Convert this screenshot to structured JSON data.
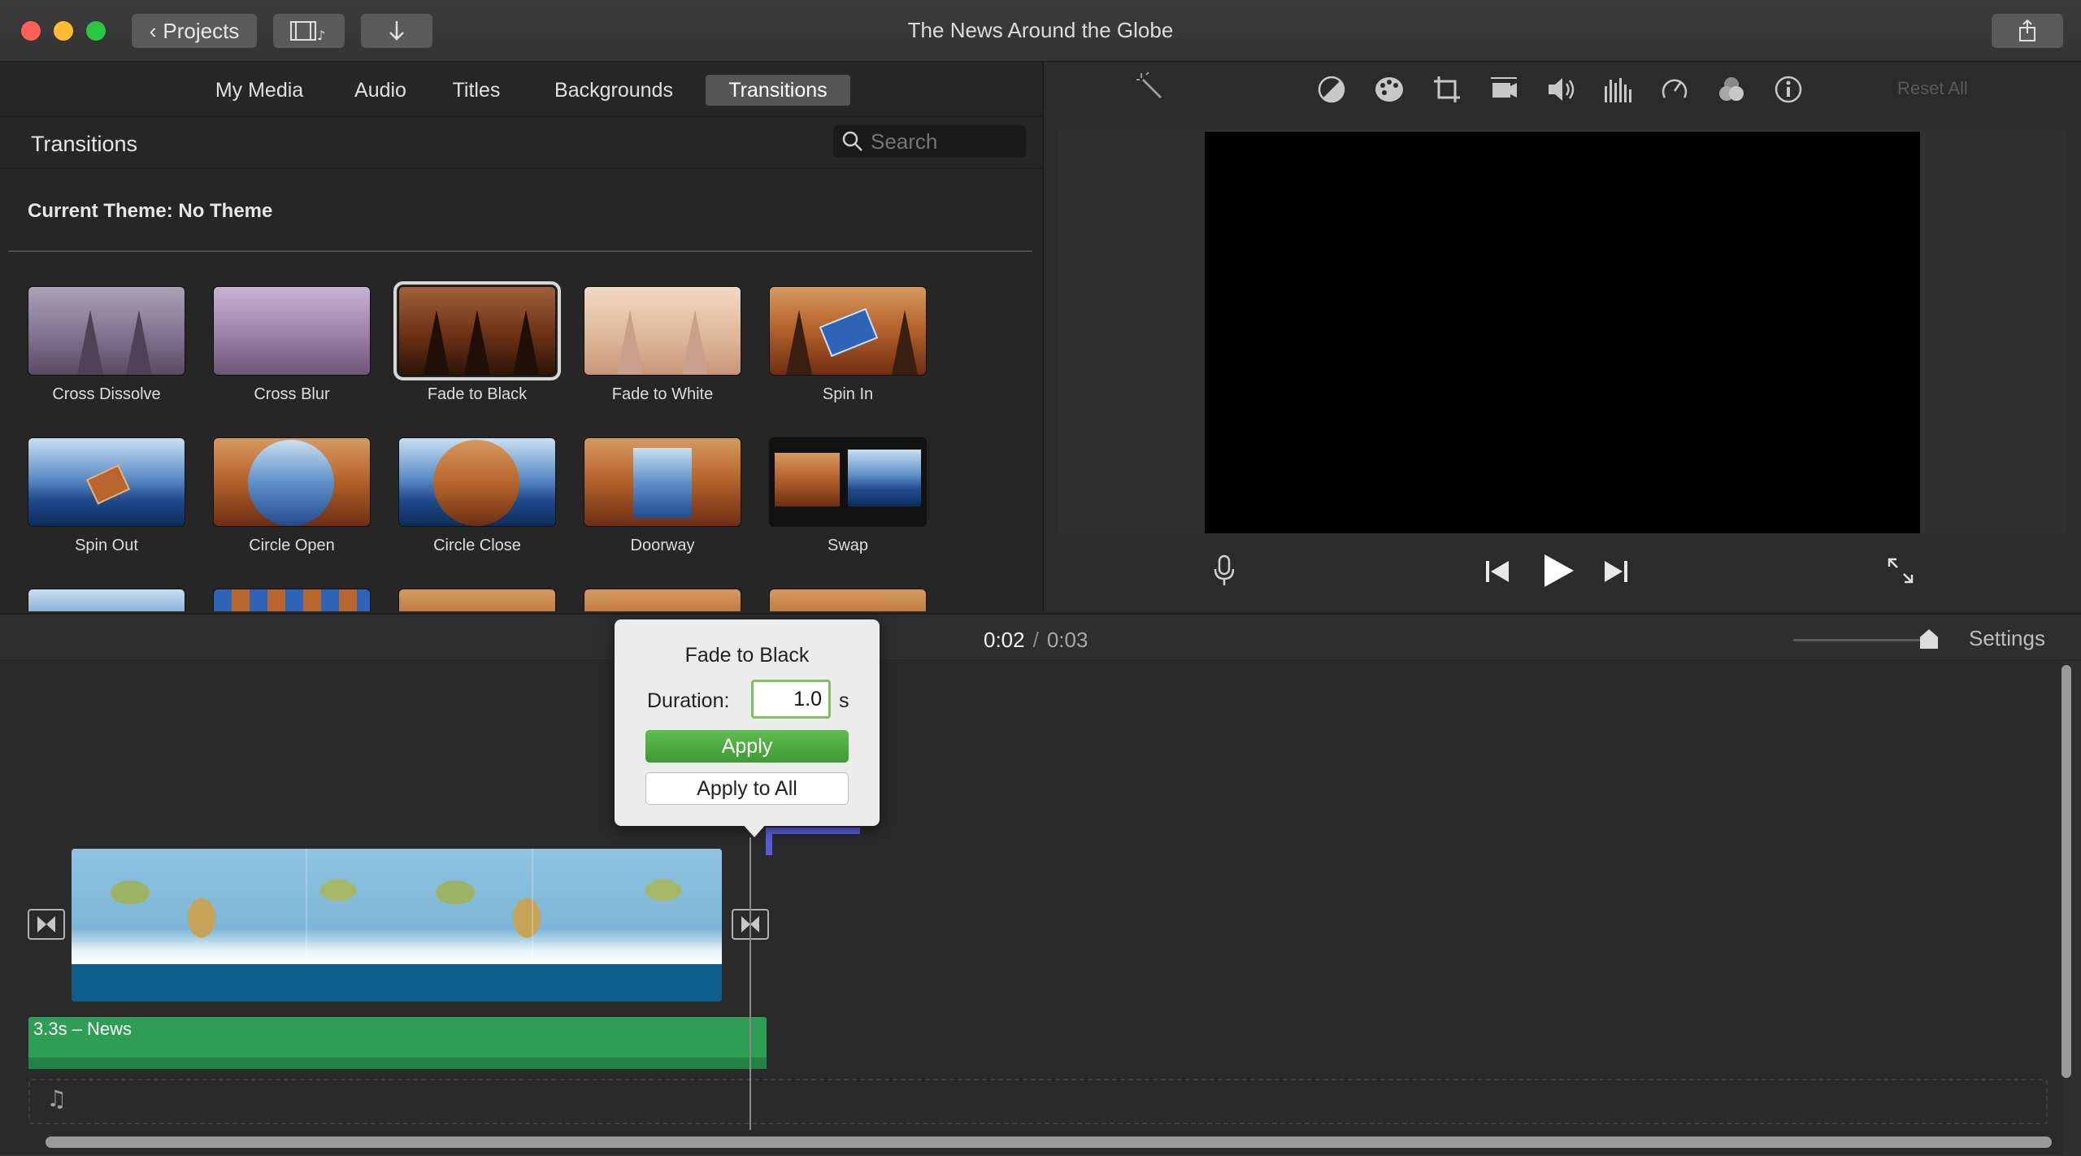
{
  "window": {
    "title": "The News Around the Globe"
  },
  "toolbar": {
    "projects_label": "Projects"
  },
  "browser": {
    "tabs": [
      {
        "label": "My Media",
        "active": false
      },
      {
        "label": "Audio",
        "active": false
      },
      {
        "label": "Titles",
        "active": false
      },
      {
        "label": "Backgrounds",
        "active": false
      },
      {
        "label": "Transitions",
        "active": true
      }
    ],
    "section_title": "Transitions",
    "search_placeholder": "Search",
    "theme_label": "Current Theme: No Theme",
    "transitions": [
      {
        "label": "Cross Dissolve"
      },
      {
        "label": "Cross Blur"
      },
      {
        "label": "Fade to Black",
        "selected": true
      },
      {
        "label": "Fade to White"
      },
      {
        "label": "Spin In"
      },
      {
        "label": "Spin Out"
      },
      {
        "label": "Circle Open"
      },
      {
        "label": "Circle Close"
      },
      {
        "label": "Doorway"
      },
      {
        "label": "Swap"
      }
    ]
  },
  "viewer": {
    "reset_label": "Reset All"
  },
  "timeline": {
    "current_time": "0:02",
    "separator": "/",
    "total_time": "0:03",
    "settings_label": "Settings",
    "audio_clip_label": "3.3s – News"
  },
  "popover": {
    "title": "Fade to Black",
    "duration_label": "Duration:",
    "duration_value": "1.0",
    "unit": "s",
    "apply_label": "Apply",
    "apply_all_label": "Apply to All"
  },
  "colors": {
    "accent_green": "#3e9a35",
    "audio_green": "#2e9e55",
    "playhead_blue": "#5b5bd6"
  }
}
